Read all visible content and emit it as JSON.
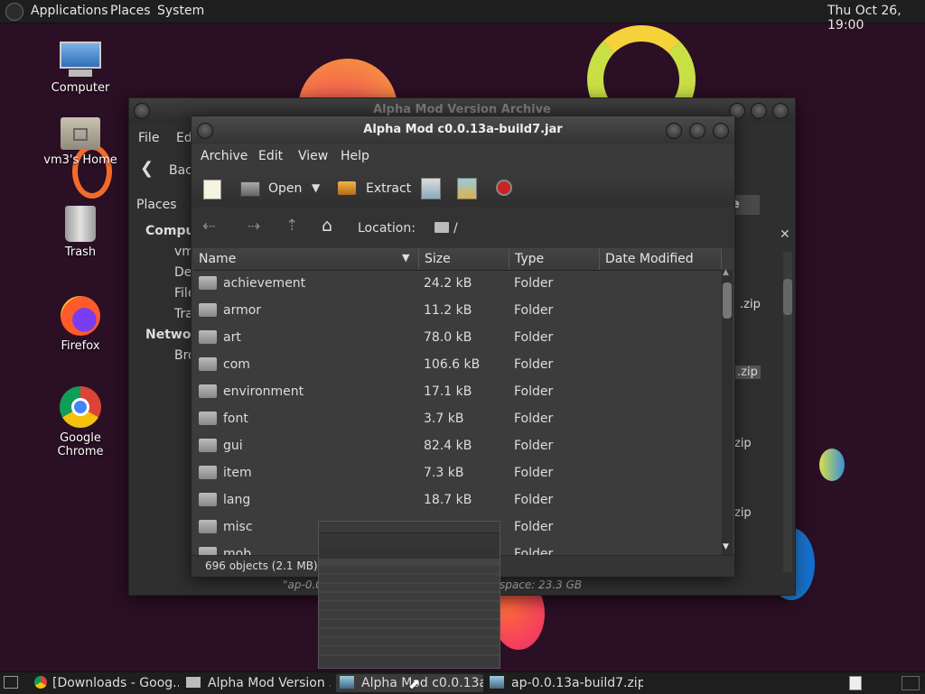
{
  "top_panel": {
    "menus": [
      "Applications",
      "Places",
      "System"
    ],
    "clock": "Thu Oct 26, 19:00"
  },
  "desktop_icons": [
    "Computer",
    "vm3's Home",
    "Trash",
    "Firefox",
    "Google Chrome"
  ],
  "back_window": {
    "title": "Alpha Mod Version Archive",
    "menu": [
      "File",
      "Ed"
    ],
    "back_label": "Bac",
    "sidebar_header": "Places",
    "sidebar_computer": "Comput",
    "sidebar_items": [
      "vm",
      "De",
      "File",
      "Tra"
    ],
    "sidebar_network": "Network",
    "sidebar_net_items": [
      "Bro"
    ],
    "right_button": "ive",
    "zip_labels": [
      ".zip",
      ".zip",
      "zip",
      "zip"
    ],
    "status": "\"ap-0.0.1",
    "free_space": "space: 23.3 GB"
  },
  "archive_window": {
    "title": "Alpha Mod c0.0.13a-build7.jar",
    "menu": [
      "Archive",
      "Edit",
      "View",
      "Help"
    ],
    "toolbar": {
      "open": "Open",
      "extract": "Extract"
    },
    "location_label": "Location:",
    "location_path": "/",
    "columns": [
      "Name",
      "Size",
      "Type",
      "Date Modified"
    ],
    "rows": [
      {
        "name": "achievement",
        "size": "24.2 kB",
        "type": "Folder"
      },
      {
        "name": "armor",
        "size": "11.2 kB",
        "type": "Folder"
      },
      {
        "name": "art",
        "size": "78.0 kB",
        "type": "Folder"
      },
      {
        "name": "com",
        "size": "106.6 kB",
        "type": "Folder"
      },
      {
        "name": "environment",
        "size": "17.1 kB",
        "type": "Folder"
      },
      {
        "name": "font",
        "size": "3.7 kB",
        "type": "Folder"
      },
      {
        "name": "gui",
        "size": "82.4 kB",
        "type": "Folder"
      },
      {
        "name": "item",
        "size": "7.3 kB",
        "type": "Folder"
      },
      {
        "name": "lang",
        "size": "18.7 kB",
        "type": "Folder"
      },
      {
        "name": "misc",
        "size": "",
        "type": "Folder"
      },
      {
        "name": "mob",
        "size": "",
        "type": "Folder"
      }
    ],
    "status": "696 objects (2.1 MB)"
  },
  "taskbar": {
    "tasks": [
      "[Downloads - Goog...",
      "Alpha Mod Version ...",
      "Alpha Mod c0.0.13a...",
      "ap-0.0.13a-build7.zip"
    ]
  },
  "colors": {
    "accent_orange": "#f47a2c",
    "accent_yellow": "#f0d12a",
    "desktop_bg": "#2b0f24"
  }
}
